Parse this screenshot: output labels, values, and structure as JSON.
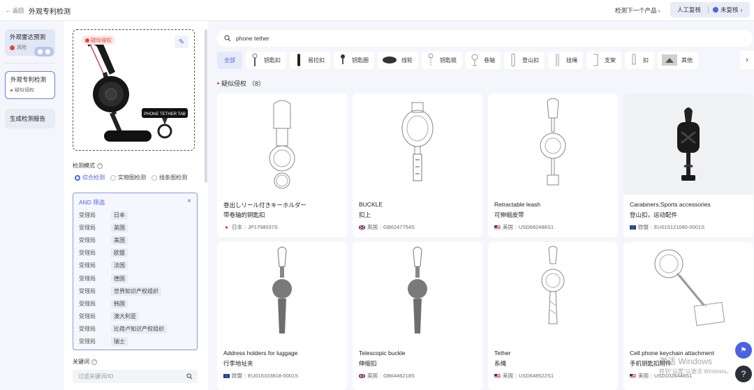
{
  "header": {
    "back_label": "返回",
    "title": "外观专利检测",
    "next_product_label": "检测下一个产品",
    "manual_review_label": "人工复核",
    "review_status": "未复核"
  },
  "left_nav": {
    "items": [
      {
        "title": "外观雷达预测",
        "sub": "风险"
      },
      {
        "title": "外观专利检测",
        "sub": "疑似侵权"
      },
      {
        "title": "生成检测报告",
        "sub": ""
      }
    ]
  },
  "preview": {
    "badge": "疑似侵权",
    "product_label": "PHONE TETHER TAB"
  },
  "detect_mode": {
    "label": "检测模式",
    "options": [
      "综合检测",
      "实物图检测",
      "线条图检测"
    ],
    "selected": "综合检测"
  },
  "filter": {
    "title": "AND 筛选",
    "rows": [
      {
        "key": "受理局",
        "value": "日本"
      },
      {
        "key": "受理局",
        "value": "英国"
      },
      {
        "key": "受理局",
        "value": "美国"
      },
      {
        "key": "受理局",
        "value": "欧盟"
      },
      {
        "key": "受理局",
        "value": "法国"
      },
      {
        "key": "受理局",
        "value": "德国"
      },
      {
        "key": "受理局",
        "value": "世界知识产权组织"
      },
      {
        "key": "受理局",
        "value": "韩国"
      },
      {
        "key": "受理局",
        "value": "澳大利亚"
      },
      {
        "key": "受理局",
        "value": "比荷卢知识产权组织"
      },
      {
        "key": "受理局",
        "value": "瑞士"
      }
    ]
  },
  "keyword": {
    "label": "关键词",
    "placeholder": "过滤关键词/ID"
  },
  "search": {
    "query": "phone tether"
  },
  "categories": [
    "全部",
    "钥匙扣",
    "易拉扣",
    "钥匙圈",
    "线轮",
    "钥匙链",
    "卷轴",
    "登山扣",
    "挂绳",
    "支架",
    "扣",
    "其他"
  ],
  "section": {
    "label": "疑似侵权",
    "count": "（8）"
  },
  "results": [
    {
      "title": "巻出しリール付きキーホルダー",
      "subtitle": "带卷轴的钥匙扣",
      "country": "日本",
      "patent_id": "JP1798037S",
      "flag": "jp"
    },
    {
      "title": "BUCKLE",
      "subtitle": "扣上",
      "country": "英国",
      "patent_id": "GB6247754S",
      "flag": "gb"
    },
    {
      "title": "Retractable leash",
      "subtitle": "可伸缩皮带",
      "country": "美国",
      "patent_id": "USD682488S1",
      "flag": "us"
    },
    {
      "title": "Carabiners,Sports accessories",
      "subtitle": "登山扣，运动配件",
      "country": "欧盟",
      "patent_id": "EU015121080-0001S",
      "flag": "eu"
    },
    {
      "title": "Address holders for luggage",
      "subtitle": "行李地址夹",
      "country": "欧盟",
      "patent_id": "EU015103818-0001S",
      "flag": "eu"
    },
    {
      "title": "Telescopic buckle",
      "subtitle": "伸缩扣",
      "country": "英国",
      "patent_id": "GB6446218S",
      "flag": "gb"
    },
    {
      "title": "Tether",
      "subtitle": "系绳",
      "country": "美国",
      "patent_id": "USD648522S1",
      "flag": "us"
    },
    {
      "title": "Cell phone keychain attachment",
      "subtitle": "手机钥匙扣附件",
      "country": "美国",
      "patent_id": "USD1026448S1",
      "flag": "us"
    }
  ],
  "watermark": {
    "line1": "激活 Windows",
    "line2": "转到\"设置\"以激活 Windows。"
  },
  "colors": {
    "accent": "#4b63e0",
    "danger": "#e8443a",
    "page_bg": "#f4f6fb"
  }
}
